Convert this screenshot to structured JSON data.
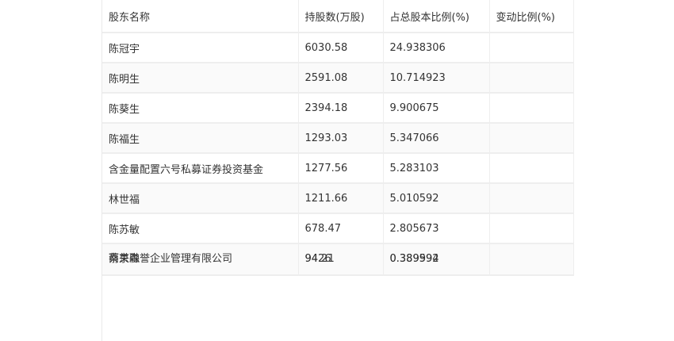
{
  "table": {
    "headers": [
      "股东名称",
      "持股数(万股)",
      "占总股本比例(%)",
      "变动比例(%)"
    ],
    "rows": [
      {
        "name": "陈冠宇",
        "shares": "6030.58",
        "ratio": "24.938306",
        "change": ""
      },
      {
        "name": "陈明生",
        "shares": "2591.08",
        "ratio": "10.714923",
        "change": ""
      },
      {
        "name": "陈葵生",
        "shares": "2394.18",
        "ratio": "9.900675",
        "change": ""
      },
      {
        "name": "陈福生",
        "shares": "1293.03",
        "ratio": "5.347066",
        "change": ""
      },
      {
        "name": "含金量配置六号私募证券投资基金",
        "shares": "1277.56",
        "ratio": "5.283103",
        "change": ""
      },
      {
        "name": "林世福",
        "shares": "1211.66",
        "ratio": "5.010592",
        "change": ""
      },
      {
        "name": "陈苏敏",
        "shares": "678.47",
        "ratio": "2.805673",
        "change": ""
      }
    ],
    "overlapped_row": {
      "name_a": "蔡关森",
      "name_b": "南京融誉企业管理有限公司",
      "shares_a": "94.21",
      "shares_b": "9426",
      "ratio_a": "0.389592",
      "ratio_b": "0.389994",
      "change": ""
    }
  }
}
